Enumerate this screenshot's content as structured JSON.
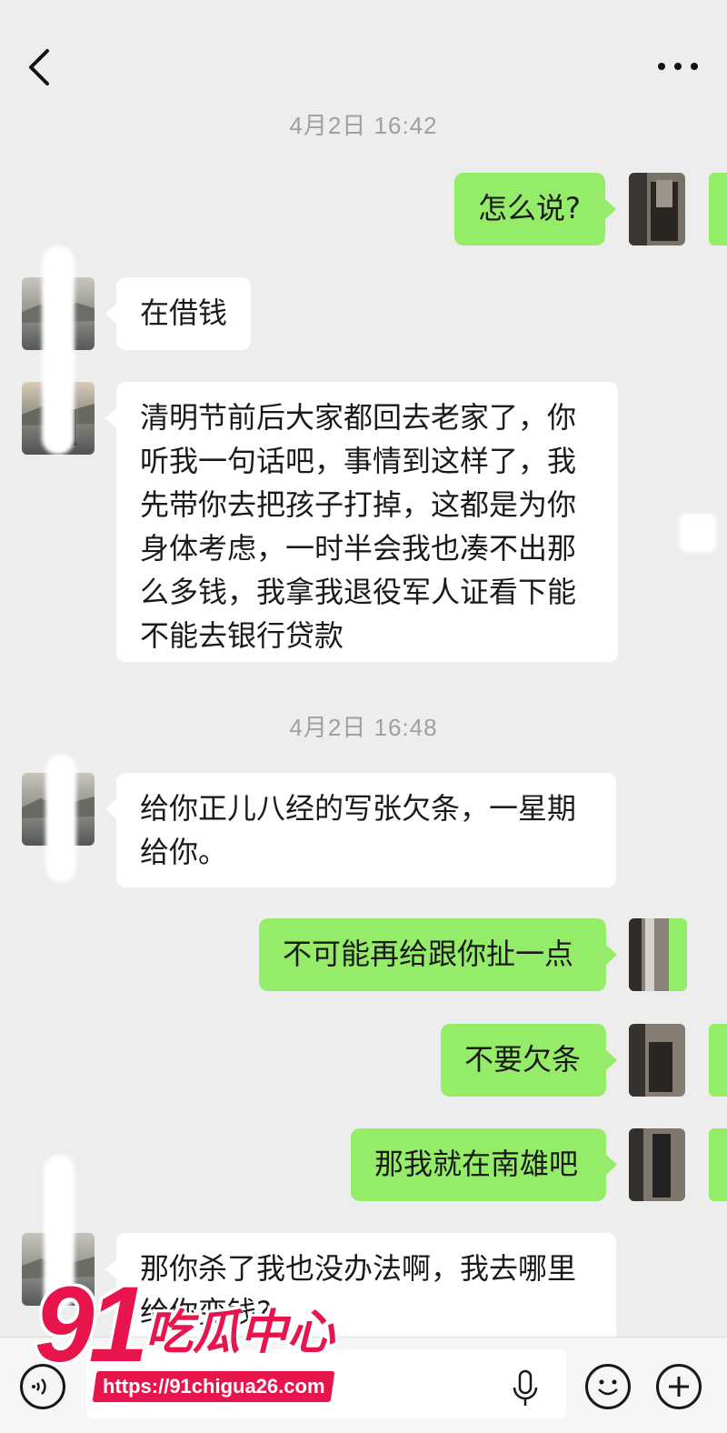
{
  "header": {
    "back_icon": "chevron-left-icon",
    "more_icon": "more-dots-icon"
  },
  "timestamps": [
    "4月2日 16:42",
    "4月2日 16:48"
  ],
  "messages": [
    {
      "side": "right",
      "text": "怎么说?"
    },
    {
      "side": "left",
      "text": "在借钱"
    },
    {
      "side": "left",
      "text": "清明节前后大家都回去老家了，你听我一句话吧，事情到这样了，我先带你去把孩子打掉，这都是为你身体考虑，一时半会我也凑不出那么多钱，我拿我退役军人证看下能不能去银行贷款"
    },
    {
      "side": "left",
      "text": "给你正儿八经的写张欠条，一星期给你。"
    },
    {
      "side": "right",
      "text": "不可能再给跟你扯一点"
    },
    {
      "side": "right",
      "text": "不要欠条"
    },
    {
      "side": "right",
      "text": "那我就在南雄吧"
    },
    {
      "side": "left",
      "text": "那你杀了我也没办法啊，我去哪里给你变钱?"
    }
  ],
  "input_bar": {
    "voice_icon": "voice-icon",
    "mic_icon": "microphone-icon",
    "emoji_icon": "emoji-icon",
    "add_icon": "plus-icon"
  },
  "watermark": {
    "number": "91",
    "name": "吃瓜中心",
    "url": "https://91chigua26.com"
  },
  "colors": {
    "bubble_green": "#95ec69",
    "bubble_white": "#ffffff",
    "background": "#ededed",
    "watermark_red": "#e8154c"
  }
}
